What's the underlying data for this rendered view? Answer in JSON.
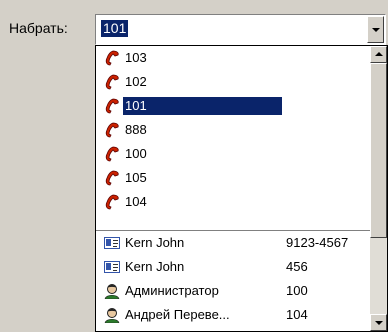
{
  "dial": {
    "label": "Набрать:",
    "value": "101"
  },
  "phones": [
    {
      "number": "103",
      "icon": "red-phone-handset-icon"
    },
    {
      "number": "102",
      "icon": "red-phone-handset-icon"
    },
    {
      "number": "101",
      "icon": "red-phone-handset-icon",
      "selected": true
    },
    {
      "number": "888",
      "icon": "red-phone-handset-icon"
    },
    {
      "number": "100",
      "icon": "red-phone-handset-icon"
    },
    {
      "number": "105",
      "icon": "red-phone-handset-icon"
    },
    {
      "number": "104",
      "icon": "red-phone-handset-icon"
    }
  ],
  "contacts": [
    {
      "name": "Kern John",
      "number": "9123-4567",
      "icon": "contact-card-icon"
    },
    {
      "name": "Kern John",
      "number": "456",
      "icon": "contact-card-icon"
    },
    {
      "name": "Администратор",
      "number": "100",
      "icon": "user-icon"
    },
    {
      "name": "Андрей Переве...",
      "number": "104",
      "icon": "user-icon"
    }
  ],
  "colors": {
    "selection": "#0a246a",
    "handset": "#cc2200",
    "card": "#3355aa",
    "background": "#d4d0c8"
  }
}
